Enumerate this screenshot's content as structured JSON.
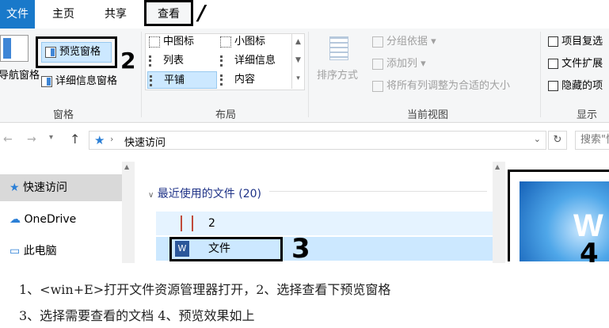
{
  "tabs": {
    "file": "文件",
    "home": "主页",
    "share": "共享",
    "view": "查看"
  },
  "pane_group": {
    "nav_pane": "导航窗格",
    "preview_pane": "预览窗格",
    "details_pane": "详细信息窗格",
    "label": "窗格"
  },
  "layout_group": {
    "items": [
      "中图标",
      "小图标",
      "列表",
      "详细信息",
      "平铺",
      "内容"
    ],
    "label": "布局"
  },
  "current_view_group": {
    "sort_by": "排序方式",
    "group_by": "分组依据",
    "add_column": "添加列",
    "fit_columns": "将所有列调整为合适的大小",
    "label": "当前视图"
  },
  "show_group": {
    "item_checkbox": "项目复选",
    "file_ext": "文件扩展",
    "hidden_items": "隐藏的项",
    "label": "显示"
  },
  "address": {
    "path": "快速访问",
    "search_placeholder": "搜索\"快"
  },
  "nav": {
    "quick_access": "快速访问",
    "onedrive": "OneDrive",
    "this_pc": "此电脑"
  },
  "files": {
    "section": "最近使用的文件 (20)",
    "rows": [
      "2",
      "文件"
    ]
  },
  "preview_text": "W",
  "annotations": {
    "n1": "/",
    "n2": "2",
    "n3": "3",
    "n4": "4",
    "line1": "1、<win+E>打开文件资源管理器打开，2、选择查看下预览窗格",
    "line2": "3、选择需要查看的文档 4、预览效果如上"
  },
  "colors": {
    "accent": "#1979ca",
    "selected": "#cce8ff"
  }
}
